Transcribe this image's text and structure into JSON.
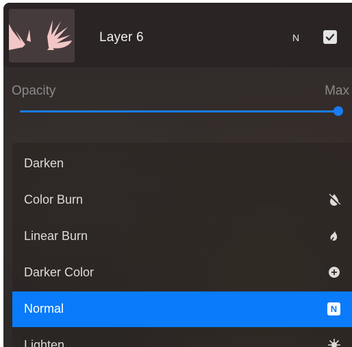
{
  "layer": {
    "name": "Layer 6",
    "blend_mode_letter": "N",
    "visible": true
  },
  "opacity": {
    "label": "Opacity",
    "value_label": "Max",
    "value_fraction": 1.0
  },
  "blend_modes": [
    {
      "label": "Darken",
      "icon": "moon-icon"
    },
    {
      "label": "Color Burn",
      "icon": "burn-drop-icon"
    },
    {
      "label": "Linear Burn",
      "icon": "flame-icon"
    },
    {
      "label": "Darker Color",
      "icon": "plus-circle-icon"
    },
    {
      "label": "Normal",
      "icon": "n-badge-icon",
      "selected": true,
      "badge": "N"
    },
    {
      "label": "Lighten",
      "icon": "sunburst-icon"
    }
  ],
  "colors": {
    "accent": "#0a7bfa",
    "panel_bg": "#2f2a2a",
    "thumbnail_art": "#f2c6c6"
  }
}
